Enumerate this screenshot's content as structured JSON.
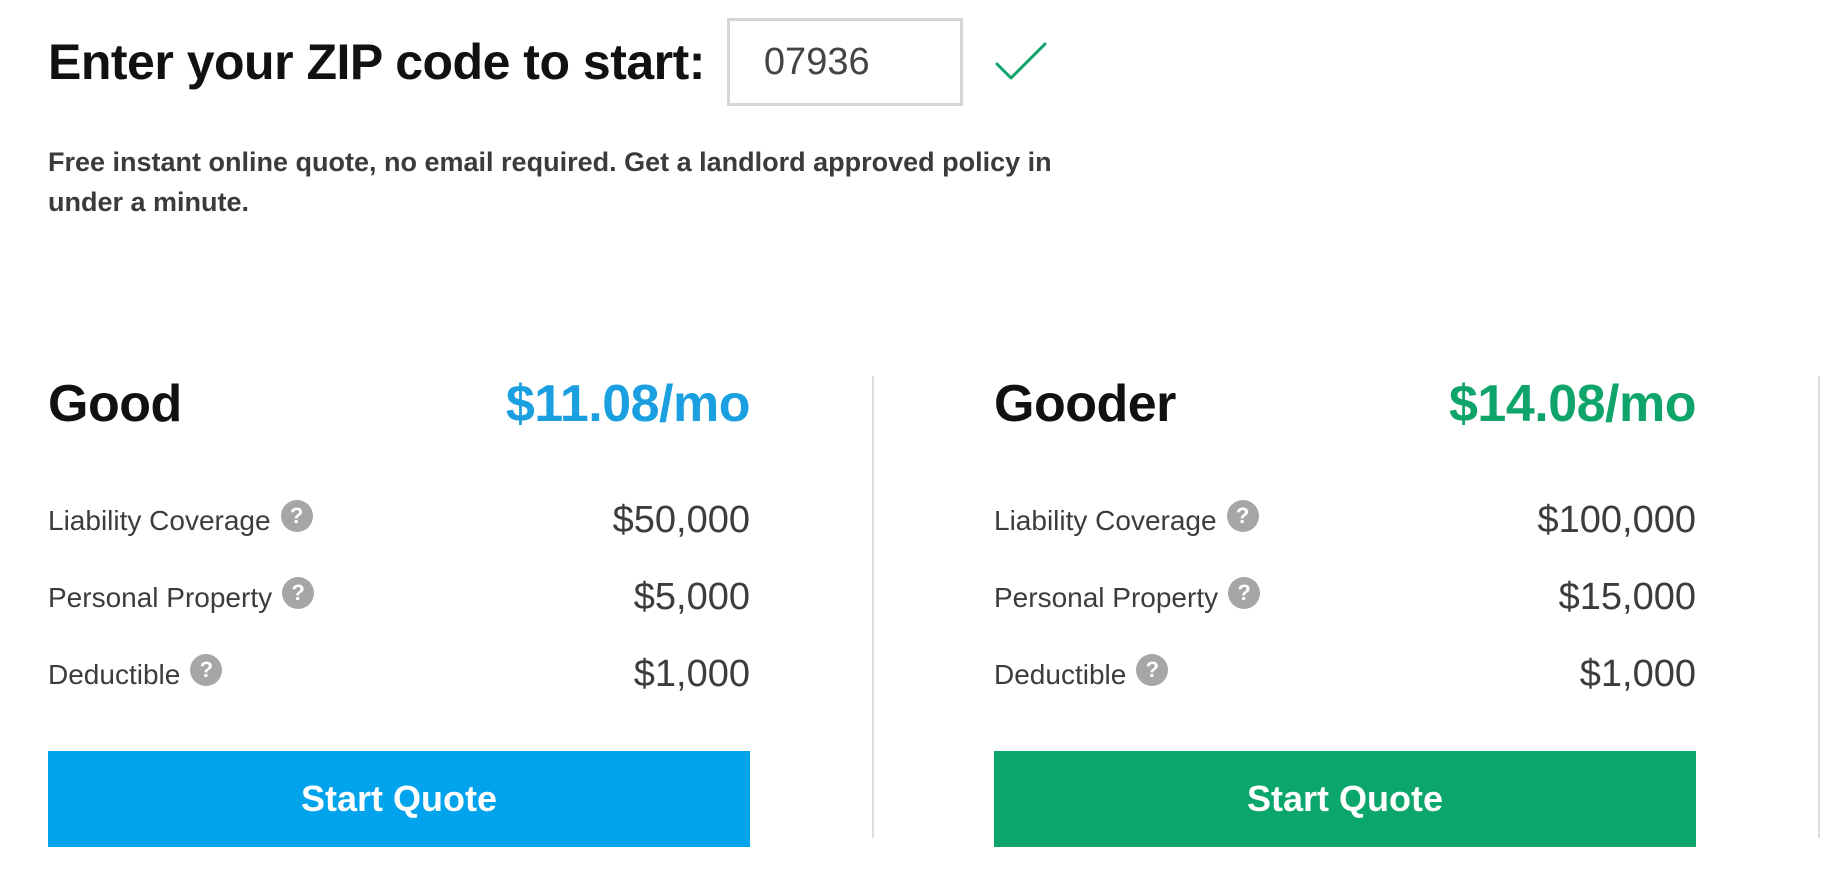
{
  "zip": {
    "heading": "Enter your ZIP code to start:",
    "value": "07936",
    "status_icon": "check-icon",
    "status_color": "#0fa56a"
  },
  "tagline": "Free instant online quote, no email required. Get a landlord approved policy in under a minute.",
  "plans": [
    {
      "name": "Good",
      "price": "$11.08/mo",
      "price_color": "#1a9fe0",
      "rows": [
        {
          "label": "Liability Coverage",
          "value": "$50,000"
        },
        {
          "label": "Personal Property",
          "value": "$5,000"
        },
        {
          "label": "Deductible",
          "value": "$1,000"
        }
      ],
      "button_label": "Start Quote",
      "button_color": "#00a3ec"
    },
    {
      "name": "Gooder",
      "price": "$14.08/mo",
      "price_color": "#0fa56a",
      "rows": [
        {
          "label": "Liability Coverage",
          "value": "$100,000"
        },
        {
          "label": "Personal Property",
          "value": "$15,000"
        },
        {
          "label": "Deductible",
          "value": "$1,000"
        }
      ],
      "button_label": "Start Quote",
      "button_color": "#0aa66b"
    }
  ],
  "help_icon_glyph": "?"
}
